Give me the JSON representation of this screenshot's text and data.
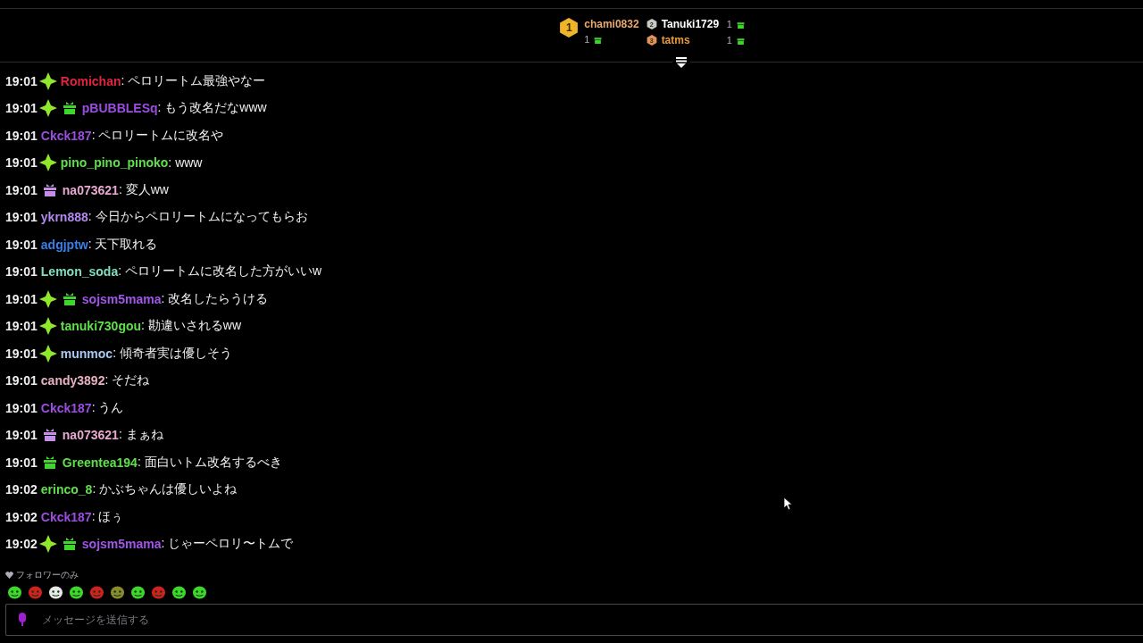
{
  "leaderboard": [
    {
      "rank": "1",
      "name": "chami0832",
      "count": "1",
      "color": "#f0b429"
    },
    {
      "rank": "2",
      "name": "Tanuki1729",
      "count": "1",
      "color": "#c8c8c8"
    },
    {
      "rank": "3",
      "name": "tatms",
      "count": "1",
      "color": "#e0935a"
    }
  ],
  "messages": [
    {
      "time": "19:01",
      "badges": [
        {
          "kind": "sparkle"
        }
      ],
      "user": "Romichan",
      "color": "#e0243c",
      "text": ": ペロリートム最強やなー"
    },
    {
      "time": "19:01",
      "badges": [
        {
          "kind": "sparkle"
        },
        {
          "kind": "gift-green"
        }
      ],
      "user": "pBUBBLESq",
      "color": "#9b4de0",
      "text": ": もう改名だなwww"
    },
    {
      "time": "19:01",
      "user": "Ckck187",
      "color": "#9b4de0",
      "text": ": ペロリートムに改名や"
    },
    {
      "time": "19:01",
      "badges": [
        {
          "kind": "sparkle"
        }
      ],
      "user": "pino_pino_pinoko",
      "color": "#5ee04a",
      "text": ": www"
    },
    {
      "time": "19:01",
      "badges": [
        {
          "kind": "gift-purple"
        }
      ],
      "user": "na073621",
      "color": "#e8a8d0",
      "text": ": 変人ww"
    },
    {
      "time": "19:01",
      "user": "ykrn888",
      "color": "#b488f0",
      "text": ": 今日からペロリートムになってもらお"
    },
    {
      "time": "19:01",
      "user": "adgjptw",
      "color": "#3a7ee8",
      "text": ": 天下取れる"
    },
    {
      "time": "19:01",
      "user": "Lemon_soda",
      "color": "#7ee0c0",
      "text": ": ペロリートムに改名した方がいいw"
    },
    {
      "time": "19:01",
      "badges": [
        {
          "kind": "sparkle"
        },
        {
          "kind": "gift-green"
        }
      ],
      "user": "sojsm5mama",
      "color": "#a056e8",
      "text": ": 改名したらうける"
    },
    {
      "time": "19:01",
      "badges": [
        {
          "kind": "sparkle"
        }
      ],
      "user": "tanuki730gou",
      "color": "#5ee04a",
      "text": ": 勘違いされるww"
    },
    {
      "time": "19:01",
      "badges": [
        {
          "kind": "sparkle"
        }
      ],
      "user": "munmoc",
      "color": "#a8c8f0",
      "text": ": 傾奇者実は優しそう"
    },
    {
      "time": "19:01",
      "user": "candy3892",
      "color": "#e8b0c0",
      "text": ": そだね"
    },
    {
      "time": "19:01",
      "user": "Ckck187",
      "color": "#9b4de0",
      "text": ": うん"
    },
    {
      "time": "19:01",
      "badges": [
        {
          "kind": "gift-purple"
        }
      ],
      "user": "na073621",
      "color": "#e8a8d0",
      "text": ": まぁね"
    },
    {
      "time": "19:01",
      "badges": [
        {
          "kind": "gift-green"
        }
      ],
      "user": "Greentea194",
      "color": "#5ee04a",
      "text": ": 面白いトム改名するべき"
    },
    {
      "time": "19:02",
      "user": "erinco_8",
      "color": "#5ee04a",
      "text": ": かぶちゃんは優しいよね"
    },
    {
      "time": "19:02",
      "user": "Ckck187",
      "color": "#9b4de0",
      "text": ": ほぅ"
    },
    {
      "time": "19:02",
      "badges": [
        {
          "kind": "sparkle"
        },
        {
          "kind": "gift-green"
        }
      ],
      "user": "sojsm5mama",
      "color": "#a056e8",
      "text": ": じゃーペロリ〜トムで"
    }
  ],
  "chat_mode": "フォロワーのみ",
  "input": {
    "placeholder": "メッセージを送信する"
  }
}
